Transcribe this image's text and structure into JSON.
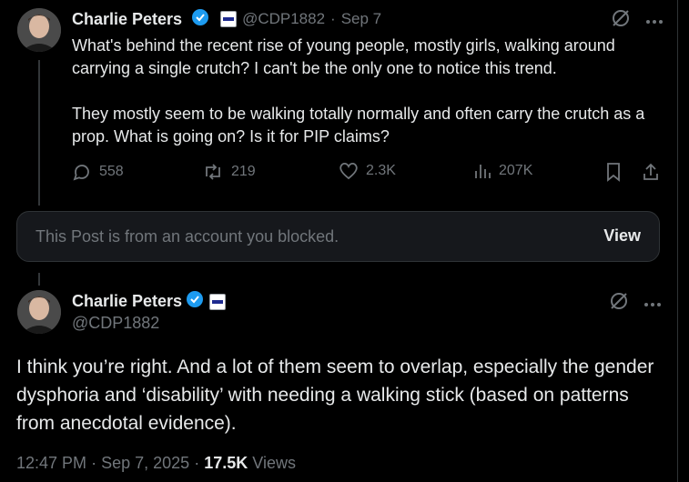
{
  "post1": {
    "name": "Charlie Peters",
    "handle": "@CDP1882",
    "date": "Sep 7",
    "separator": "·",
    "text": "What's behind the recent rise of young people, mostly girls, walking around carrying a single crutch? I can't be the only one to notice this trend.\n\nThey mostly seem to be walking totally normally and often carry the crutch as a prop. What is going on? Is it for PIP claims?",
    "replies": "558",
    "reposts": "219",
    "likes": "2.3K",
    "views": "207K"
  },
  "blocked": {
    "text": "This Post is from an account you blocked.",
    "view_label": "View"
  },
  "post2": {
    "name": "Charlie Peters",
    "handle": "@CDP1882",
    "text": "I think you’re right. And a lot of them seem to overlap, especially the gender dysphoria and ‘disability’ with needing a walking stick (based on patterns from anecdotal evidence).",
    "time": "12:47 PM",
    "date": "Sep 7, 2025",
    "views_count": "17.5K",
    "views_label": "Views",
    "separator": "·"
  },
  "icons": {
    "verified": "verified-badge-icon",
    "affiliate": "affiliate-badge-icon",
    "grok": "grok-icon",
    "more": "more-icon",
    "reply": "reply-icon",
    "repost": "repost-icon",
    "like": "like-icon",
    "views": "views-icon",
    "bookmark": "bookmark-icon",
    "share": "share-icon"
  },
  "colors": {
    "background": "#000000",
    "text": "#e7e9ea",
    "muted": "#71767b",
    "verified": "#1d9bf0",
    "blocked_bg": "#16181c"
  }
}
